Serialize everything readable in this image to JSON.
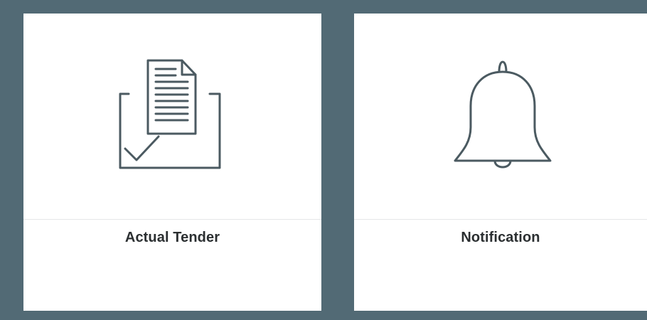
{
  "tiles": [
    {
      "label": "Actual Tender",
      "icon": "tender-document-check-icon"
    },
    {
      "label": "Notification",
      "icon": "bell-icon"
    }
  ],
  "colors": {
    "background": "#526a75",
    "tile": "#ffffff",
    "icon_stroke": "#4b5a61",
    "label": "#2b2f31"
  }
}
